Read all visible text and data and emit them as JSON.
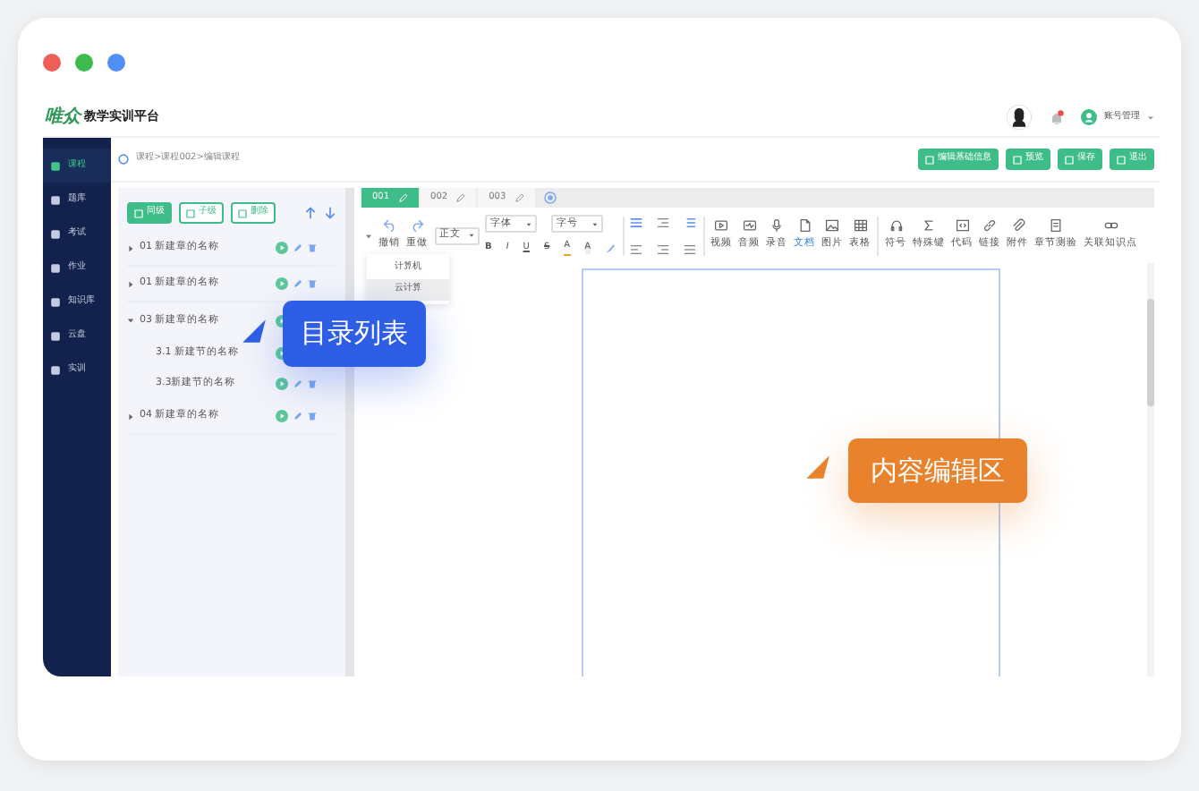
{
  "header": {
    "logo": "唯众",
    "title": "教学实训平台",
    "user": "账号管理"
  },
  "sidebar": {
    "items": [
      {
        "label": "课程",
        "selected": true
      },
      {
        "label": "题库",
        "selected": false
      },
      {
        "label": "考试",
        "selected": false
      },
      {
        "label": "作业",
        "selected": false
      },
      {
        "label": "知识库",
        "selected": false
      },
      {
        "label": "云盘",
        "selected": false
      },
      {
        "label": "实训",
        "selected": false
      }
    ]
  },
  "breadcrumb": "课程>课程002>编辑课程",
  "actions": [
    "编辑基础信息",
    "预览",
    "保存",
    "退出"
  ],
  "outline": {
    "buttons": [
      {
        "label": "同级",
        "kind": "solid"
      },
      {
        "label": "子级",
        "kind": "outline"
      },
      {
        "label": "删除",
        "kind": "outline"
      }
    ],
    "chapters": [
      {
        "title": "01 新建章的名称",
        "expanded": false
      },
      {
        "title": "01 新建章的名称",
        "expanded": false
      },
      {
        "title": "03 新建章的名称",
        "expanded": true,
        "children": [
          {
            "title": "3.1 新建节的名称"
          },
          {
            "title": "3.3新建节的名称"
          }
        ]
      },
      {
        "title": "04 新建章的名称",
        "expanded": false
      }
    ]
  },
  "editor": {
    "tabs": [
      {
        "label": "001",
        "selected": true
      },
      {
        "label": "002",
        "selected": false
      },
      {
        "label": "003",
        "selected": false
      }
    ],
    "history": [
      {
        "kind": "undo",
        "label": "撤销"
      },
      {
        "kind": "redo",
        "label": "重做"
      }
    ],
    "paragraph_style": "正文",
    "font": "字体",
    "size": "字号",
    "format": [
      "B",
      "I",
      "U",
      "S",
      "A",
      "A"
    ],
    "media_tools": [
      {
        "kind": "video",
        "label": "视频",
        "selected": false
      },
      {
        "kind": "audio",
        "label": "音频",
        "selected": false
      },
      {
        "kind": "record",
        "label": "录音",
        "selected": false
      },
      {
        "kind": "document",
        "label": "文档",
        "selected": true
      },
      {
        "kind": "image",
        "label": "图片",
        "selected": false
      },
      {
        "kind": "table",
        "label": "表格",
        "selected": false
      }
    ],
    "insert_tools": [
      {
        "kind": "symbol",
        "label": "符号",
        "selected": false
      },
      {
        "kind": "special",
        "label": "特殊键",
        "selected": false
      },
      {
        "kind": "code",
        "label": "代码",
        "selected": false
      },
      {
        "kind": "link",
        "label": "链接",
        "selected": false
      },
      {
        "kind": "attachment",
        "label": "附件",
        "selected": false
      },
      {
        "kind": "quiz",
        "label": "章节测验",
        "selected": false
      },
      {
        "kind": "related",
        "label": "关联知识点",
        "selected": false
      }
    ],
    "menu": [
      {
        "label": "计算机",
        "selected": false
      },
      {
        "label": "云计算",
        "selected": true
      }
    ]
  },
  "callouts": [
    {
      "text": "目录列表",
      "color": "#2f5ee6"
    },
    {
      "text": "内容编辑区",
      "color": "#e8822c"
    }
  ]
}
